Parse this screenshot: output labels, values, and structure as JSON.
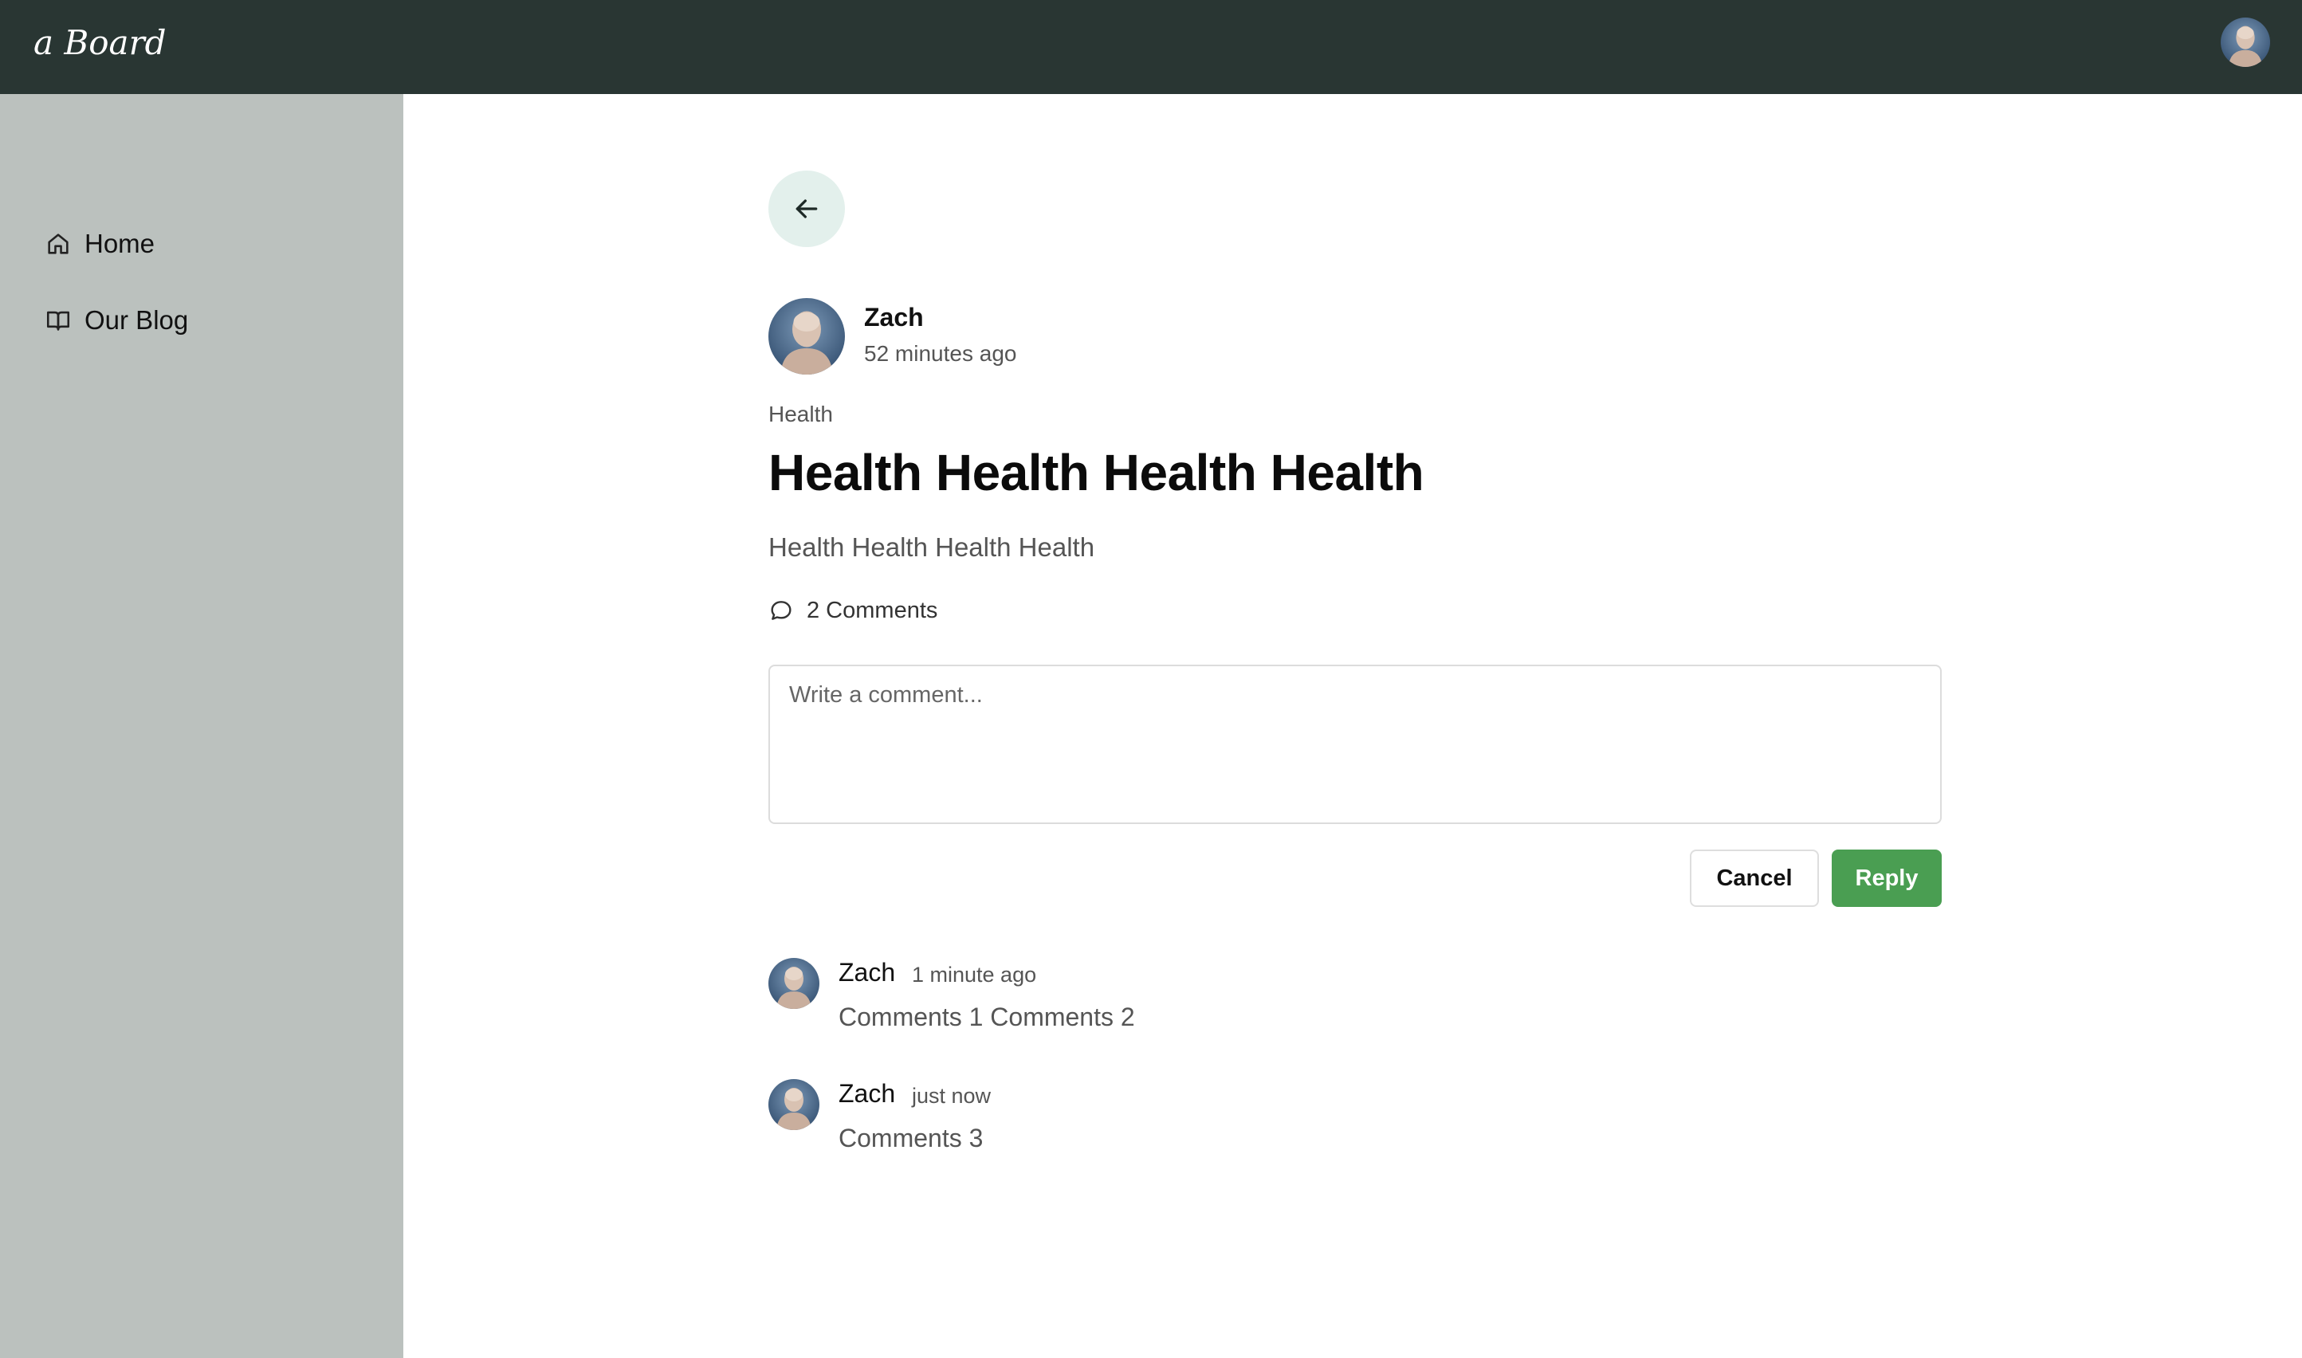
{
  "app": {
    "brand": "a Board"
  },
  "sidebar": {
    "items": [
      {
        "label": "Home",
        "icon": "home-icon"
      },
      {
        "label": "Our Blog",
        "icon": "book-open-icon"
      }
    ]
  },
  "post": {
    "author": "Zach",
    "time": "52 minutes ago",
    "category": "Health",
    "title": "Health Health Health Health",
    "body": "Health Health Health Health",
    "comments_label": "2 Comments"
  },
  "comment_form": {
    "placeholder": "Write a comment...",
    "cancel_label": "Cancel",
    "reply_label": "Reply"
  },
  "comments": [
    {
      "author": "Zach",
      "time": "1 minute ago",
      "text": "Comments 1 Comments 2"
    },
    {
      "author": "Zach",
      "time": "just now",
      "text": "Comments 3"
    }
  ],
  "colors": {
    "topbar": "#293633",
    "sidebar": "#bbc1be",
    "back_button_bg": "#e3f0ec",
    "reply_button": "#4a9e52"
  }
}
